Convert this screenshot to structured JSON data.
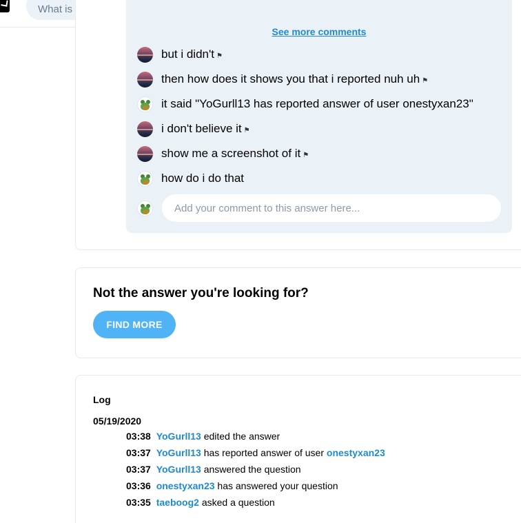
{
  "header": {
    "search_placeholder": "What is your question?"
  },
  "comments": {
    "see_more": "See more comments",
    "items": [
      {
        "avatar": "sunset-avatar",
        "text": "but i didn't",
        "flag": true
      },
      {
        "avatar": "sunset-avatar",
        "text": "then how does it shows you that i reported nuh uh",
        "flag": true
      },
      {
        "avatar": "frog-avatar",
        "text": "it said \"YoGurll13 has reported answer of user onestyxan23\"",
        "flag": false
      },
      {
        "avatar": "sunset-avatar",
        "text": "i don't believe it",
        "flag": true
      },
      {
        "avatar": "sunset-avatar",
        "text": "show me a screenshot of it",
        "flag": true
      },
      {
        "avatar": "frog-avatar",
        "text": "how do i do that",
        "flag": false
      }
    ],
    "input_placeholder": "Add your comment to this answer here..."
  },
  "not_answer": {
    "title": "Not the answer you're looking for?",
    "button": "FIND MORE"
  },
  "log": {
    "title": "Log",
    "date": "05/19/2020",
    "entries": [
      {
        "time": "03:38",
        "user": "YoGurll13",
        "action": "edited the answer",
        "target": ""
      },
      {
        "time": "03:37",
        "user": "YoGurll13",
        "action": "has reported answer of user",
        "target": "onestyxan23"
      },
      {
        "time": "03:37",
        "user": "YoGurll13",
        "action": "answered the question",
        "target": ""
      },
      {
        "time": "03:36",
        "user": "onestyxan23",
        "action": "has answered your question",
        "target": ""
      },
      {
        "time": "03:35",
        "user": "taeboog2",
        "action": "asked a question",
        "target": ""
      }
    ]
  },
  "colors": {
    "accent": "#1e8acd",
    "button": "#4fb3f6",
    "panel": "#ebf2f7"
  }
}
